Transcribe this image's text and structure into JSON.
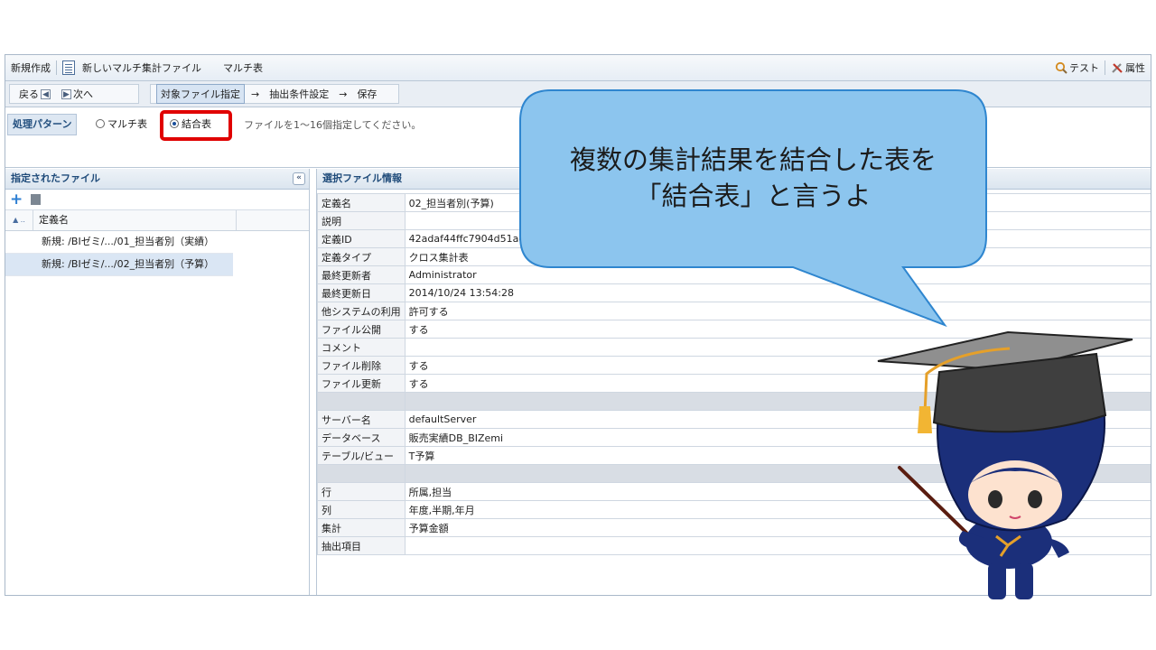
{
  "topbar": {
    "new_label": "新規作成",
    "file_title": "新しいマルチ集計ファイル",
    "table_type": "マルチ表",
    "test_label": "テスト",
    "props_label": "属性"
  },
  "nav": {
    "back_label": "戻る",
    "next_label": "次へ",
    "steps": [
      "対象ファイル指定",
      "抽出条件設定",
      "保存"
    ],
    "arrow": "→"
  },
  "pattern": {
    "label": "処理パターン",
    "options": [
      "マルチ表",
      "結合表"
    ],
    "selected": "結合表",
    "hint": "ファイルを1〜16個指定してください。"
  },
  "left_panel": {
    "title": "指定されたファイル",
    "column": "定義名",
    "files": [
      "新規: /BIゼミ/.../01_担当者別（実績）",
      "新規: /BIゼミ/.../02_担当者別（予算）"
    ],
    "selected_index": 1
  },
  "right_panel": {
    "title": "選択ファイル情報",
    "rows": [
      {
        "k": "定義名",
        "v": "02_担当者別(予算)"
      },
      {
        "k": "説明",
        "v": ""
      },
      {
        "k": "定義ID",
        "v": "42adaf44ffc7904d51ae79"
      },
      {
        "k": "定義タイプ",
        "v": "クロス集計表"
      },
      {
        "k": "最終更新者",
        "v": "Administrator"
      },
      {
        "k": "最終更新日",
        "v": "2014/10/24 13:54:28"
      },
      {
        "k": "他システムの利用",
        "v": "許可する"
      },
      {
        "k": "ファイル公開",
        "v": "する"
      },
      {
        "k": "コメント",
        "v": ""
      },
      {
        "k": "ファイル削除",
        "v": "する"
      },
      {
        "k": "ファイル更新",
        "v": "する"
      },
      {
        "k": "",
        "v": "",
        "gap": true
      },
      {
        "k": "サーバー名",
        "v": "defaultServer"
      },
      {
        "k": "データベース",
        "v": "販売実績DB_BIZemi"
      },
      {
        "k": "テーブル/ビュー",
        "v": "T予算"
      },
      {
        "k": "",
        "v": "",
        "gap": true
      },
      {
        "k": "行",
        "v": "所属,担当"
      },
      {
        "k": "列",
        "v": "年度,半期,年月"
      },
      {
        "k": "集計",
        "v": "予算金額"
      },
      {
        "k": "抽出項目",
        "v": ""
      }
    ]
  },
  "callout": {
    "line1": "複数の集計結果を結合した表を",
    "line2": "「結合表」と言うよ"
  },
  "colors": {
    "bubble_fill": "#8cc5ee",
    "bubble_stroke": "#2f86cf",
    "highlight": "#e00000",
    "mascot_body": "#1b2f7a"
  }
}
